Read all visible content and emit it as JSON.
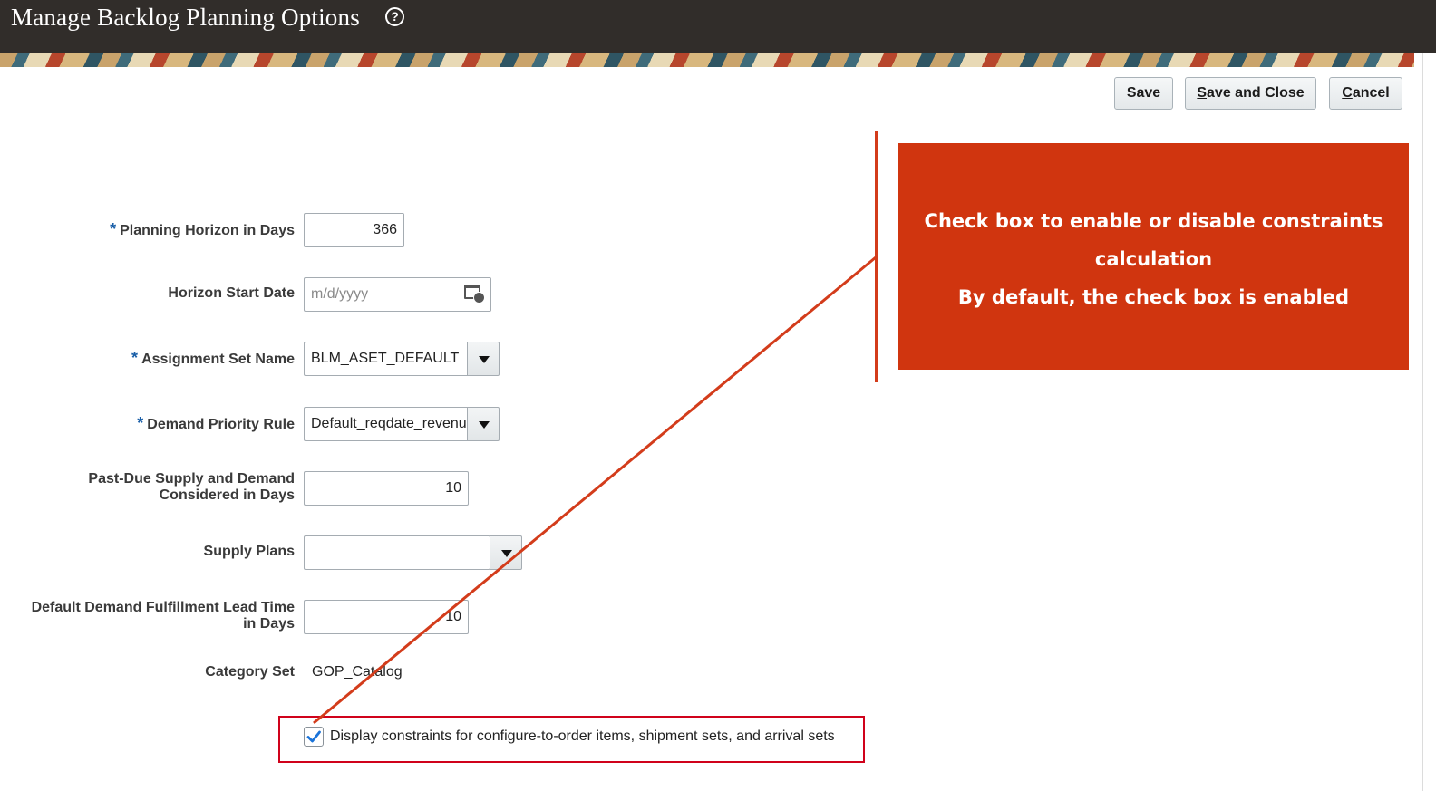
{
  "header": {
    "title": "Manage Backlog Planning Options",
    "help_glyph": "?"
  },
  "toolbar": {
    "save_label": "Save",
    "save_close_first": "S",
    "save_close_rest": "ave and Close",
    "cancel_first": "C",
    "cancel_rest": "ancel"
  },
  "form": {
    "planning_horizon": {
      "label": "Planning Horizon in Days",
      "required": "*",
      "value": "366"
    },
    "horizon_start": {
      "label": "Horizon Start Date",
      "placeholder": "m/d/yyyy"
    },
    "assignment_set": {
      "label": "Assignment Set Name",
      "required": "*",
      "value": "BLM_ASET_DEFAULT"
    },
    "demand_priority": {
      "label": "Demand Priority Rule",
      "required": "*",
      "value": "Default_reqdate_revenu"
    },
    "past_due": {
      "label_line1": "Past-Due Supply and Demand",
      "label_line2": "Considered in Days",
      "value": "10"
    },
    "supply_plans": {
      "label": "Supply Plans",
      "value": ""
    },
    "lead_time": {
      "label_line1": "Default Demand Fulfillment Lead Time",
      "label_line2": "in Days",
      "value": "10"
    },
    "category_set": {
      "label": "Category Set",
      "value": "GOP_Catalog"
    },
    "constraints_checkbox": {
      "label": "Display constraints for configure-to-order items, shipment sets, and arrival sets",
      "checked": true
    }
  },
  "callout": {
    "line1": "Check box to enable or disable constraints",
    "line2": "calculation",
    "line3": "By default, the check box is enabled"
  },
  "colors": {
    "header_bg": "#312d2a",
    "callout_bg": "#d0350f",
    "highlight_border": "#d0021b",
    "required_star": "#1a5fa8",
    "check_blue": "#1a73d9"
  }
}
